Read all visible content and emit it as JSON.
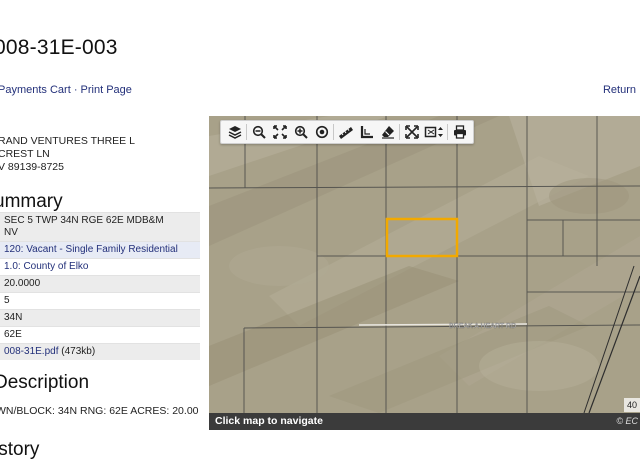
{
  "page": {
    "title": "008-31E-003"
  },
  "links": {
    "payments_cart": "Payments Cart",
    "separator": "·",
    "print_page": "Print Page",
    "return": "Return"
  },
  "owner": {
    "line1": "RAND VENTURES THREE L",
    "line2": "CREST LN",
    "line3": "V 89139-8725"
  },
  "summary": {
    "heading": "ummary",
    "rows": [
      {
        "value": "SEC 5 TWP 34N RGE 62E MDB&M",
        "value2": "NV"
      },
      {
        "value": "120: Vacant - Single Family Residential"
      },
      {
        "value": "1.0: County of Elko"
      },
      {
        "value": "20.0000"
      },
      {
        "value": "5"
      },
      {
        "value": "34N"
      },
      {
        "value": "62E"
      },
      {
        "value": "008-31E.pdf",
        "suffix": " (473kb)"
      }
    ]
  },
  "description": {
    "heading": "Description",
    "text": "WN/BLOCK: 34N RNG: 62E ACRES: 20.00"
  },
  "history": {
    "heading": "istory"
  },
  "map": {
    "footer_text": "Click map to navigate",
    "credit": "© EC",
    "scale": "40",
    "road_label": "BREAK A HEART RD",
    "parcel_color": "#f2a900",
    "toolbar": [
      {
        "name": "layers-icon"
      },
      {
        "name": "zoom-out-icon"
      },
      {
        "name": "full-extent-icon"
      },
      {
        "name": "zoom-in-icon"
      },
      {
        "name": "locate-icon"
      },
      {
        "name": "measure-icon"
      },
      {
        "name": "area-measure-icon"
      },
      {
        "name": "erase-icon"
      },
      {
        "name": "fullscreen-icon"
      },
      {
        "name": "select-icon"
      },
      {
        "name": "print-icon"
      }
    ]
  }
}
